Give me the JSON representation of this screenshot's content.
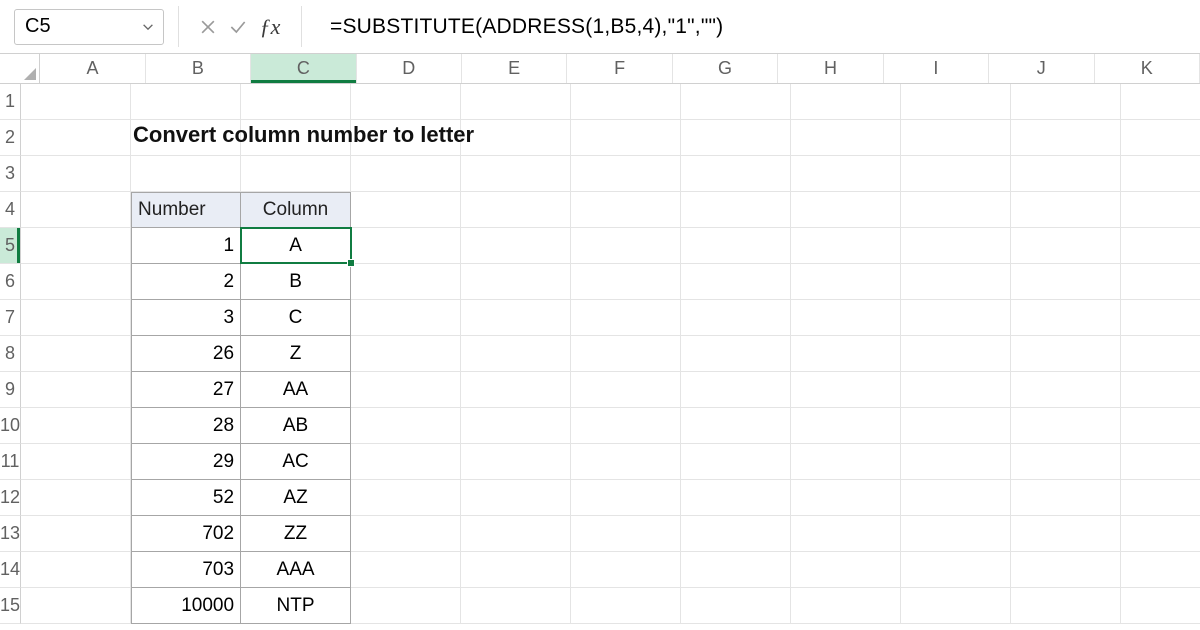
{
  "namebox": {
    "value": "C5"
  },
  "formula_bar": {
    "formula": "=SUBSTITUTE(ADDRESS(1,B5,4),\"1\",\"\")"
  },
  "columns": [
    "A",
    "B",
    "C",
    "D",
    "E",
    "F",
    "G",
    "H",
    "I",
    "J",
    "K"
  ],
  "rows": [
    "1",
    "2",
    "3",
    "4",
    "5",
    "6",
    "7",
    "8",
    "9",
    "10",
    "11",
    "12",
    "13",
    "14",
    "15"
  ],
  "selected_column": "C",
  "selected_row": "5",
  "title": "Convert column number to letter",
  "table": {
    "headers": {
      "number": "Number",
      "column": "Column"
    },
    "rows": [
      {
        "number": "1",
        "column": "A"
      },
      {
        "number": "2",
        "column": "B"
      },
      {
        "number": "3",
        "column": "C"
      },
      {
        "number": "26",
        "column": "Z"
      },
      {
        "number": "27",
        "column": "AA"
      },
      {
        "number": "28",
        "column": "AB"
      },
      {
        "number": "29",
        "column": "AC"
      },
      {
        "number": "52",
        "column": "AZ"
      },
      {
        "number": "702",
        "column": "ZZ"
      },
      {
        "number": "703",
        "column": "AAA"
      },
      {
        "number": "10000",
        "column": "NTP"
      }
    ]
  }
}
